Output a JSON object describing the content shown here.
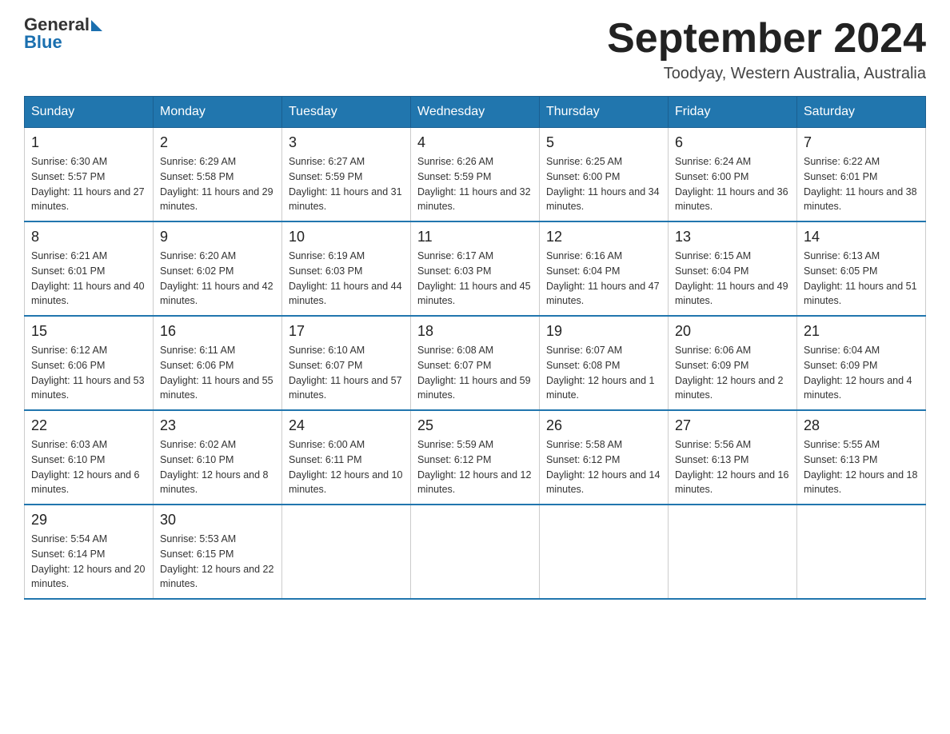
{
  "header": {
    "logo_line1": "General",
    "logo_line2": "Blue",
    "month_title": "September 2024",
    "subtitle": "Toodyay, Western Australia, Australia"
  },
  "days_of_week": [
    "Sunday",
    "Monday",
    "Tuesday",
    "Wednesday",
    "Thursday",
    "Friday",
    "Saturday"
  ],
  "weeks": [
    [
      {
        "day": "1",
        "sunrise": "6:30 AM",
        "sunset": "5:57 PM",
        "daylight": "11 hours and 27 minutes."
      },
      {
        "day": "2",
        "sunrise": "6:29 AM",
        "sunset": "5:58 PM",
        "daylight": "11 hours and 29 minutes."
      },
      {
        "day": "3",
        "sunrise": "6:27 AM",
        "sunset": "5:59 PM",
        "daylight": "11 hours and 31 minutes."
      },
      {
        "day": "4",
        "sunrise": "6:26 AM",
        "sunset": "5:59 PM",
        "daylight": "11 hours and 32 minutes."
      },
      {
        "day": "5",
        "sunrise": "6:25 AM",
        "sunset": "6:00 PM",
        "daylight": "11 hours and 34 minutes."
      },
      {
        "day": "6",
        "sunrise": "6:24 AM",
        "sunset": "6:00 PM",
        "daylight": "11 hours and 36 minutes."
      },
      {
        "day": "7",
        "sunrise": "6:22 AM",
        "sunset": "6:01 PM",
        "daylight": "11 hours and 38 minutes."
      }
    ],
    [
      {
        "day": "8",
        "sunrise": "6:21 AM",
        "sunset": "6:01 PM",
        "daylight": "11 hours and 40 minutes."
      },
      {
        "day": "9",
        "sunrise": "6:20 AM",
        "sunset": "6:02 PM",
        "daylight": "11 hours and 42 minutes."
      },
      {
        "day": "10",
        "sunrise": "6:19 AM",
        "sunset": "6:03 PM",
        "daylight": "11 hours and 44 minutes."
      },
      {
        "day": "11",
        "sunrise": "6:17 AM",
        "sunset": "6:03 PM",
        "daylight": "11 hours and 45 minutes."
      },
      {
        "day": "12",
        "sunrise": "6:16 AM",
        "sunset": "6:04 PM",
        "daylight": "11 hours and 47 minutes."
      },
      {
        "day": "13",
        "sunrise": "6:15 AM",
        "sunset": "6:04 PM",
        "daylight": "11 hours and 49 minutes."
      },
      {
        "day": "14",
        "sunrise": "6:13 AM",
        "sunset": "6:05 PM",
        "daylight": "11 hours and 51 minutes."
      }
    ],
    [
      {
        "day": "15",
        "sunrise": "6:12 AM",
        "sunset": "6:06 PM",
        "daylight": "11 hours and 53 minutes."
      },
      {
        "day": "16",
        "sunrise": "6:11 AM",
        "sunset": "6:06 PM",
        "daylight": "11 hours and 55 minutes."
      },
      {
        "day": "17",
        "sunrise": "6:10 AM",
        "sunset": "6:07 PM",
        "daylight": "11 hours and 57 minutes."
      },
      {
        "day": "18",
        "sunrise": "6:08 AM",
        "sunset": "6:07 PM",
        "daylight": "11 hours and 59 minutes."
      },
      {
        "day": "19",
        "sunrise": "6:07 AM",
        "sunset": "6:08 PM",
        "daylight": "12 hours and 1 minute."
      },
      {
        "day": "20",
        "sunrise": "6:06 AM",
        "sunset": "6:09 PM",
        "daylight": "12 hours and 2 minutes."
      },
      {
        "day": "21",
        "sunrise": "6:04 AM",
        "sunset": "6:09 PM",
        "daylight": "12 hours and 4 minutes."
      }
    ],
    [
      {
        "day": "22",
        "sunrise": "6:03 AM",
        "sunset": "6:10 PM",
        "daylight": "12 hours and 6 minutes."
      },
      {
        "day": "23",
        "sunrise": "6:02 AM",
        "sunset": "6:10 PM",
        "daylight": "12 hours and 8 minutes."
      },
      {
        "day": "24",
        "sunrise": "6:00 AM",
        "sunset": "6:11 PM",
        "daylight": "12 hours and 10 minutes."
      },
      {
        "day": "25",
        "sunrise": "5:59 AM",
        "sunset": "6:12 PM",
        "daylight": "12 hours and 12 minutes."
      },
      {
        "day": "26",
        "sunrise": "5:58 AM",
        "sunset": "6:12 PM",
        "daylight": "12 hours and 14 minutes."
      },
      {
        "day": "27",
        "sunrise": "5:56 AM",
        "sunset": "6:13 PM",
        "daylight": "12 hours and 16 minutes."
      },
      {
        "day": "28",
        "sunrise": "5:55 AM",
        "sunset": "6:13 PM",
        "daylight": "12 hours and 18 minutes."
      }
    ],
    [
      {
        "day": "29",
        "sunrise": "5:54 AM",
        "sunset": "6:14 PM",
        "daylight": "12 hours and 20 minutes."
      },
      {
        "day": "30",
        "sunrise": "5:53 AM",
        "sunset": "6:15 PM",
        "daylight": "12 hours and 22 minutes."
      },
      null,
      null,
      null,
      null,
      null
    ]
  ],
  "labels": {
    "sunrise_prefix": "Sunrise: ",
    "sunset_prefix": "Sunset: ",
    "daylight_prefix": "Daylight: "
  }
}
